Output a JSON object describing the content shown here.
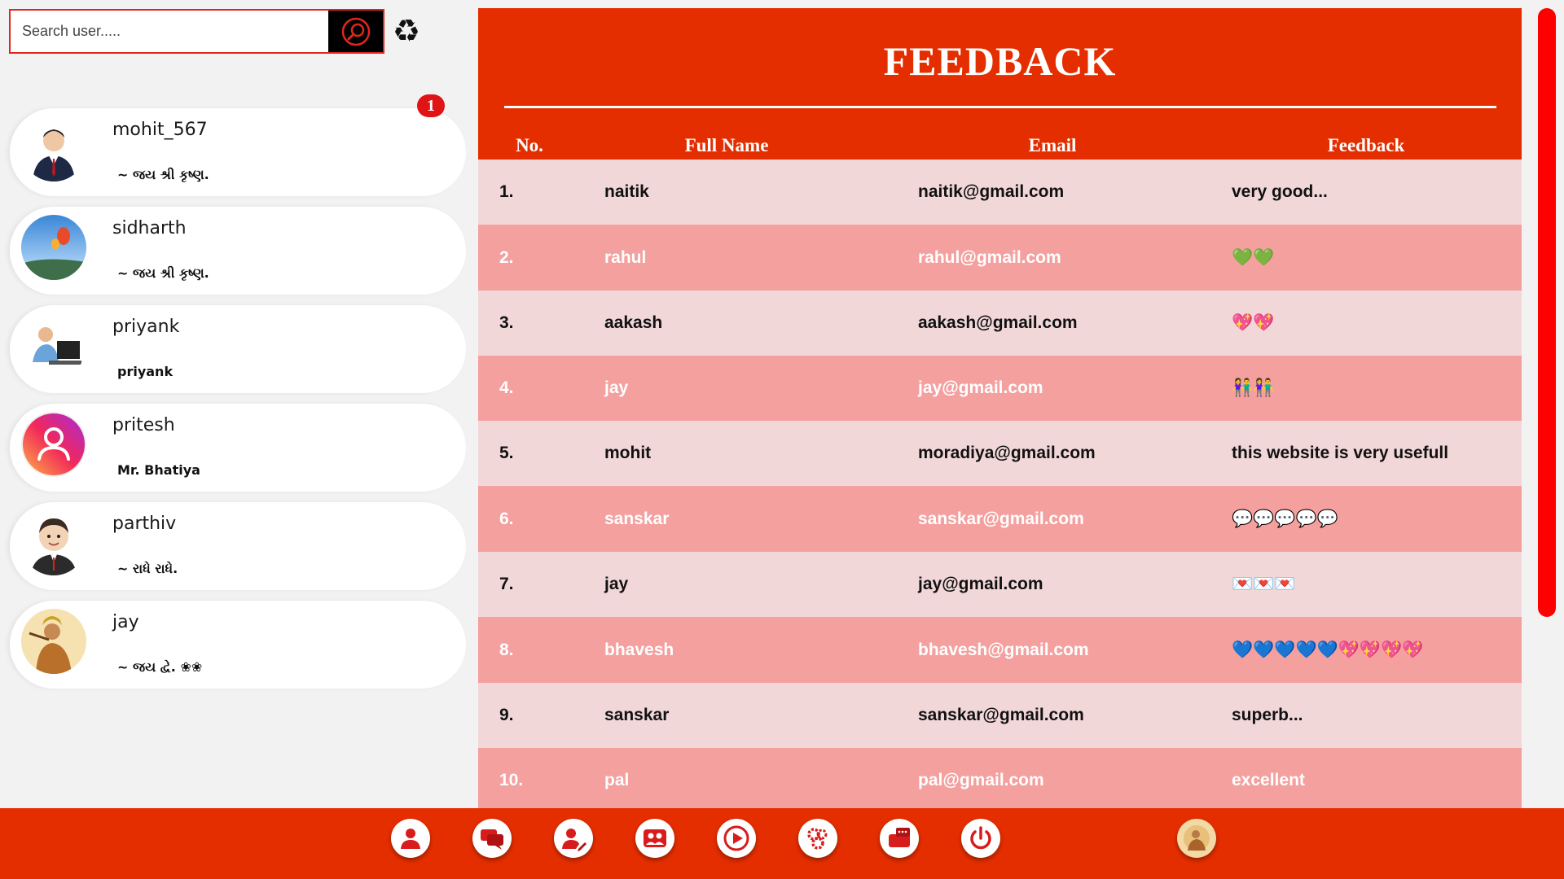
{
  "search": {
    "placeholder": "Search user....."
  },
  "users": [
    {
      "name": "mohit_567",
      "status": "~ જય શ્રી કૃષ્ણ.",
      "unread": "1"
    },
    {
      "name": "sidharth",
      "status": "~ જય શ્રી કૃષ્ણ."
    },
    {
      "name": "priyank",
      "status": "priyank"
    },
    {
      "name": "pritesh",
      "status": "Mr. Bhatiya"
    },
    {
      "name": "parthiv",
      "status": "~ રાધે રાધે."
    },
    {
      "name": "jay",
      "status": "~ જય દ્વે. ❀❀"
    }
  ],
  "feedback": {
    "title": "FEEDBACK",
    "columns": [
      "No.",
      "Full Name",
      "Email",
      "Feedback"
    ],
    "rows": [
      {
        "no": "1.",
        "name": "naitik",
        "email": "naitik@gmail.com",
        "feedback": "very good..."
      },
      {
        "no": "2.",
        "name": "rahul",
        "email": "rahul@gmail.com",
        "feedback": "💚💚"
      },
      {
        "no": "3.",
        "name": "aakash",
        "email": "aakash@gmail.com",
        "feedback": "💖💖"
      },
      {
        "no": "4.",
        "name": "jay",
        "email": "jay@gmail.com",
        "feedback": "👫👫"
      },
      {
        "no": "5.",
        "name": "mohit",
        "email": "moradiya@gmail.com",
        "feedback": "this website is very usefull"
      },
      {
        "no": "6.",
        "name": "sanskar",
        "email": "sanskar@gmail.com",
        "feedback": "💬💬💬💬💬"
      },
      {
        "no": "7.",
        "name": "jay",
        "email": "jay@gmail.com",
        "feedback": "💌💌💌"
      },
      {
        "no": "8.",
        "name": "bhavesh",
        "email": "bhavesh@gmail.com",
        "feedback": "💙💙💙💙💙💖💖💖💖"
      },
      {
        "no": "9.",
        "name": "sanskar",
        "email": "sanskar@gmail.com",
        "feedback": "superb..."
      },
      {
        "no": "10.",
        "name": "pal",
        "email": "pal@gmail.com",
        "feedback": "excellent"
      }
    ]
  },
  "colors": {
    "accent": "#e52e00",
    "row_light": "#f2d7d9",
    "row_dark": "#f4a09f",
    "scrollbar": "#ff0000"
  },
  "bottom_nav": [
    {
      "icon": "user-profile-icon"
    },
    {
      "icon": "chat-icon"
    },
    {
      "icon": "user-edit-icon"
    },
    {
      "icon": "group-icon"
    },
    {
      "icon": "video-play-icon"
    },
    {
      "icon": "settings-gears-icon"
    },
    {
      "icon": "feedback-icon"
    },
    {
      "icon": "power-icon"
    },
    {
      "icon": "profile-photo-icon"
    }
  ]
}
